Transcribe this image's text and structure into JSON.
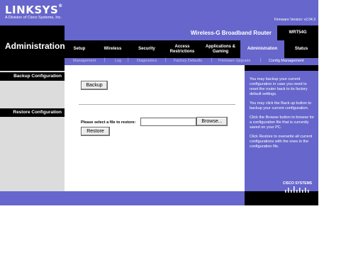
{
  "header": {
    "brand": "LINKSYS",
    "brand_mark": "®",
    "tagline": "A Division of Cisco Systems, Inc.",
    "firmware": "Firmware Version: v2.04.3",
    "product_name": "Wireless-G Broadband Router",
    "model": "WRT54G",
    "section_title": "Administration"
  },
  "tabs": [
    {
      "label": "Setup"
    },
    {
      "label": "Wireless"
    },
    {
      "label": "Security"
    },
    {
      "label": "Access Restrictions"
    },
    {
      "label": "Applications & Gaming"
    },
    {
      "label": "Administration"
    },
    {
      "label": "Status"
    }
  ],
  "subtabs": [
    {
      "label": "Management"
    },
    {
      "label": "Log"
    },
    {
      "label": "Diagnostics"
    },
    {
      "label": "Factory Defaults"
    },
    {
      "label": "Firmware Upgrade"
    },
    {
      "label": "Config Management"
    }
  ],
  "sections": {
    "backup": {
      "title": "Backup Configuration",
      "button": "Backup"
    },
    "restore": {
      "title": "Restore Configuration",
      "file_label": "Please select a file to restore:",
      "browse": "Browse...",
      "button": "Restore",
      "file_value": ""
    }
  },
  "help": {
    "p1": "You may backup your current configuration in case you need to reset the router back to its factory default settings.",
    "p2": "You may click the Back up button to backup your current configuration.",
    "p3": "Click the Browse button to browse for a configuration file that is currently saved on your PC.",
    "p4": "Click Restore to overwrite all current configurations with the ones in the configuration file.",
    "cisco": "CISCO SYSTEMS"
  },
  "colors": {
    "accent": "#6666cc",
    "dark": "#000000",
    "side": "#dcdcdc"
  }
}
